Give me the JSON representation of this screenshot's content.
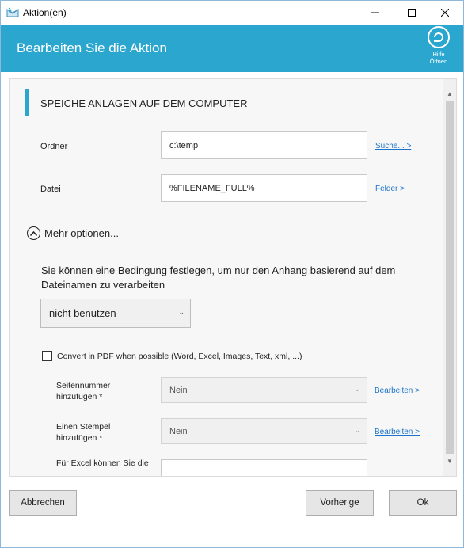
{
  "window": {
    "title": "Aktion(en)"
  },
  "banner": {
    "title": "Bearbeiten Sie die Aktion",
    "help_label_1": "Hilfe",
    "help_label_2": "Öffnen"
  },
  "section": {
    "title": "SPEICHE ANLAGEN AUF DEM COMPUTER"
  },
  "folder": {
    "label": "Ordner",
    "value": "c:\\temp",
    "link": "Suche... >"
  },
  "file": {
    "label": "Datei",
    "value": "%FILENAME_FULL%",
    "link": "Felder >"
  },
  "more_options": {
    "label": "Mehr optionen..."
  },
  "condition": {
    "description": "Sie können eine Bedingung festlegen, um nur den Anhang basierend auf dem Dateinamen zu verarbeiten",
    "selected": "nicht benutzen"
  },
  "pdf": {
    "label": "Convert in PDF when possible (Word, Excel, Images, Text, xml, ...)",
    "checked": false
  },
  "page_number": {
    "label_1": "Seitennummer",
    "label_2": "hinzufügen *",
    "value": "Nein",
    "link": "Bearbeiten >"
  },
  "stamp": {
    "label_1": "Einen Stempel",
    "label_2": "hinzufügen *",
    "value": "Nein",
    "link": "Bearbeiten >"
  },
  "excel": {
    "label": "Für Excel können Sie die"
  },
  "footer": {
    "cancel": "Abbrechen",
    "previous": "Vorherige",
    "ok": "Ok"
  },
  "colors": {
    "accent": "#2ba7cf",
    "link": "#1a73c8"
  },
  "icons": {
    "app": "envelope-icon",
    "help": "help-refresh-icon",
    "minimize": "minimize-icon",
    "maximize": "maximize-icon",
    "close": "close-icon",
    "expand": "chevron-up-icon"
  }
}
